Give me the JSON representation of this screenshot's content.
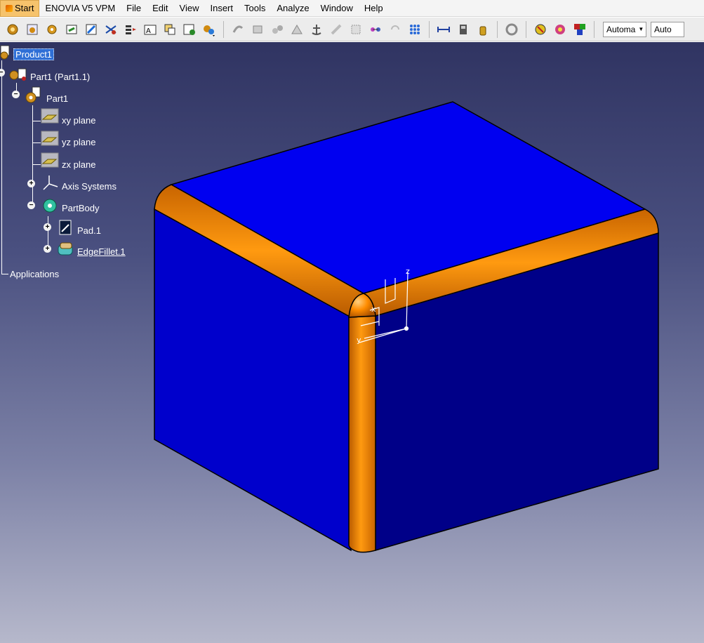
{
  "menubar": {
    "items": [
      {
        "label": "Start",
        "active": true
      },
      {
        "label": "ENOVIA V5 VPM"
      },
      {
        "label": "File"
      },
      {
        "label": "Edit"
      },
      {
        "label": "View"
      },
      {
        "label": "Insert"
      },
      {
        "label": "Tools"
      },
      {
        "label": "Analyze"
      },
      {
        "label": "Window"
      },
      {
        "label": "Help"
      }
    ]
  },
  "toolbar": {
    "combo1": "Automa",
    "combo2": "Auto"
  },
  "tree": {
    "product": "Product1",
    "part_instance": "Part1 (Part1.1)",
    "part": "Part1",
    "xy_plane": "xy plane",
    "yz_plane": "yz plane",
    "zx_plane": "zx plane",
    "axis_systems": "Axis Systems",
    "part_body": "PartBody",
    "pad": "Pad.1",
    "edge_fillet": "EdgeFillet.1",
    "applications": "Applications"
  },
  "compass": {
    "x_label": "x",
    "y_label": "y",
    "z_label": "z"
  },
  "colors": {
    "model_face_top": "#0000f0",
    "model_face_front": "#0000c8",
    "model_face_right": "#00008c",
    "fillet": "#ff8c00",
    "selection": "#2f6fd6"
  }
}
